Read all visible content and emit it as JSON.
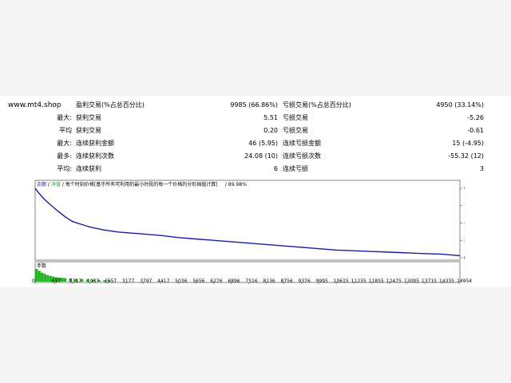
{
  "site": "www.mt4.shop",
  "stats": [
    {
      "label": "",
      "k1": "盈利交易(%占总百分比)",
      "v1": "9985 (66.86%)",
      "k2": "亏损交易(%占总百分比)",
      "v2": "4950 (33.14%)"
    },
    {
      "label": "最大:",
      "k1": "获利交易",
      "v1": "5.51",
      "k2": "亏损交易",
      "v2": "-5.26"
    },
    {
      "label": "平均",
      "k1": "获利交易",
      "v1": "0.20",
      "k2": "亏损交易",
      "v2": "-0.61"
    },
    {
      "label": "最大:",
      "k1": "连续获利金额",
      "v1": "46 (5.95)",
      "k2": "连续亏损金额",
      "v2": "15 (-4.95)"
    },
    {
      "label": "最多:",
      "k1": "连续获利次数",
      "v1": "24.08 (10)",
      "k2": "连续亏损次数",
      "v2": "-55.32 (12)"
    },
    {
      "label": "平均:",
      "k1": "连续获利",
      "v1": "6",
      "k2": "连续亏损",
      "v2": "3"
    }
  ],
  "chart": {
    "legend": {
      "balance": "余额",
      "sep1": "/",
      "equity": "净值",
      "desc": "/ 每个时刻价格[基于所有可利用的最小时段的每一个价格的分形插值计算]",
      "quality": "/ 89.98%"
    },
    "volume_label": "手数",
    "colors": {
      "balance": "#1a1aa8",
      "equity": "#2ca02c",
      "volume": "#22b422",
      "grid": "#c0c0c0"
    }
  },
  "chart_data": {
    "type": "line",
    "x_ticks": [
      "0",
      "697",
      "1317",
      "1937",
      "2557",
      "3177",
      "3797",
      "4417",
      "5036",
      "5656",
      "6276",
      "6896",
      "7516",
      "8136",
      "8756",
      "9376",
      "9995",
      "10615",
      "11235",
      "11855",
      "12475",
      "13095",
      "13715",
      "14335",
      "14954"
    ],
    "y_ticks": [
      "998",
      "749",
      "499",
      "250",
      "0"
    ],
    "ylim": [
      0,
      998
    ],
    "xlim": [
      0,
      14954
    ],
    "series": [
      {
        "name": "余额",
        "x": [
          0,
          150,
          350,
          600,
          800,
          1050,
          1317,
          1700,
          1937,
          2400,
          2900,
          3177,
          3700,
          4417,
          5036,
          5656,
          6276,
          6896,
          7516,
          8136,
          8756,
          9376,
          9995,
          10615,
          11235,
          11855,
          12475,
          13095,
          13715,
          14335,
          14954
        ],
        "y": [
          998,
          920,
          830,
          740,
          670,
          590,
          520,
          470,
          440,
          400,
          370,
          360,
          345,
          320,
          290,
          270,
          250,
          230,
          210,
          190,
          170,
          150,
          130,
          110,
          100,
          90,
          80,
          70,
          60,
          50,
          30
        ]
      }
    ],
    "volume": {
      "x": [
        0,
        100,
        200,
        300,
        400,
        500,
        600,
        700,
        800,
        900,
        1000,
        1200,
        1400,
        1600,
        1800,
        2000,
        2200,
        2400,
        2557
      ],
      "y": [
        1.0,
        0.85,
        0.7,
        0.6,
        0.5,
        0.45,
        0.4,
        0.35,
        0.32,
        0.3,
        0.28,
        0.25,
        0.22,
        0.2,
        0.18,
        0.16,
        0.14,
        0.12,
        0.1
      ]
    }
  }
}
